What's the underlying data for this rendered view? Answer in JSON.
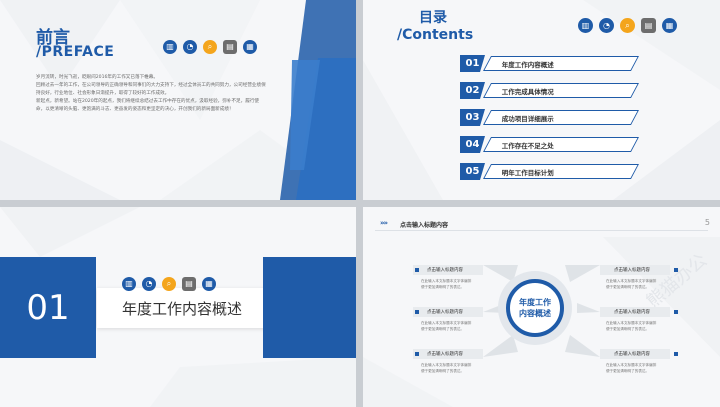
{
  "colors": {
    "brand_blue": "#1f5ba8",
    "icon_orange": "#f4a51c",
    "icon_gray": "#6d6d6d"
  },
  "icon_set": [
    "bar-chart-icon",
    "pie-chart-icon",
    "search-icon",
    "document-icon",
    "calculator-icon"
  ],
  "slide1": {
    "title_cn": "前言",
    "title_en": "/PREFACE",
    "paragraphs": [
      "岁月流转，时光飞逝，眨眼间2016年的工作又已落下帷幕。",
      "回顾过去一年的工作，在公司领导的正确领导和同事们的大力支持下，经过全体员工的共同努力，公司经营业绩保持良好，行业地位、社会形象日渐提升，取得了较好的工作成效。",
      "新起点，新希望。站在2020年的起点，我们将继续总结过去工作中存在的优点，汲取经验，弥补不足，履行使命，以更清晰的头脑、更饱满的斗志、更奋发的姿态和更坚定的决心，开创我们的新局面新成绩！"
    ]
  },
  "slide2": {
    "title_cn": "目录",
    "title_en": "/Contents",
    "items": [
      {
        "num": "01",
        "label": "年度工作内容概述"
      },
      {
        "num": "02",
        "label": "工作完成具体情况"
      },
      {
        "num": "03",
        "label": "成功项目详细展示"
      },
      {
        "num": "04",
        "label": "工作存在不足之处"
      },
      {
        "num": "05",
        "label": "明年工作目标计划"
      }
    ]
  },
  "slide3": {
    "number": "01",
    "title": "年度工作内容概述"
  },
  "slide4": {
    "header_title": "点击输入标题内容",
    "page_number": "5",
    "center_line1": "年度工作",
    "center_line2": "内容概述",
    "labels": [
      "点击输入标题内容",
      "点击输入标题内容",
      "点击输入标题内容",
      "点击输入标题内容",
      "点击输入标题内容",
      "点击输入标题内容"
    ],
    "desc_line1": "在此输入本文标题本文字体编排",
    "desc_line2": "便于更加清晰明了的表达。"
  }
}
